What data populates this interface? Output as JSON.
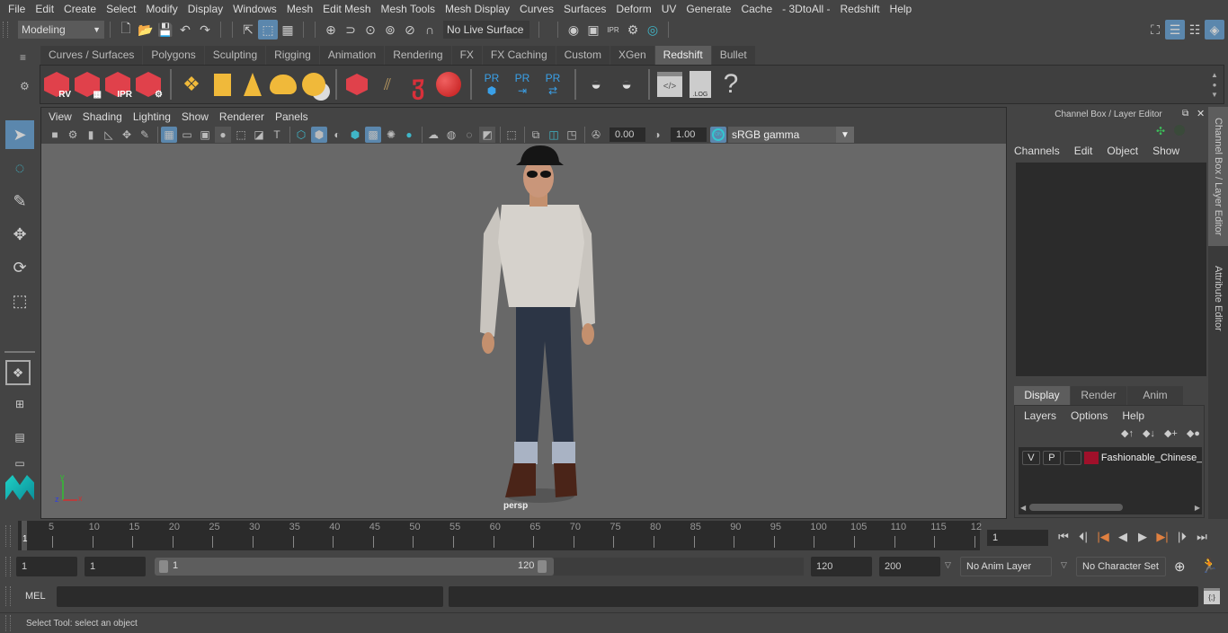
{
  "menubar": {
    "items": [
      "File",
      "Edit",
      "Create",
      "Select",
      "Modify",
      "Display",
      "Windows",
      "Mesh",
      "Edit Mesh",
      "Mesh Tools",
      "Mesh Display",
      "Curves",
      "Surfaces",
      "Deform",
      "UV",
      "Generate",
      "Cache",
      "- 3DtoAll -",
      "Redshift",
      "Help"
    ]
  },
  "statusline": {
    "mode": "Modeling",
    "live_surface": "No Live Surface"
  },
  "shelf": {
    "tabs": [
      "Curves / Surfaces",
      "Polygons",
      "Sculpting",
      "Rigging",
      "Animation",
      "Rendering",
      "FX",
      "FX Caching",
      "Custom",
      "XGen",
      "Redshift",
      "Bullet"
    ],
    "active_tab": "Redshift",
    "icons": {
      "rv": "RV",
      "ipr": "IPR",
      "pr": "PR",
      "log": ".LOG",
      "help": "?"
    }
  },
  "viewport": {
    "menu": [
      "View",
      "Shading",
      "Lighting",
      "Show",
      "Renderer",
      "Panels"
    ],
    "exposure": "0.00",
    "gamma": "1.00",
    "color_mgmt_on": "ON",
    "color_space": "sRGB gamma",
    "camera_label": "persp",
    "axis": {
      "x": "x",
      "y": "y",
      "z": "z"
    }
  },
  "channel_box": {
    "title": "Channel Box / Layer Editor",
    "menu": [
      "Channels",
      "Edit",
      "Object",
      "Show"
    ]
  },
  "layer_editor": {
    "tabs": [
      "Display",
      "Render",
      "Anim"
    ],
    "active_tab": "Display",
    "menu": [
      "Layers",
      "Options",
      "Help"
    ],
    "layers": [
      {
        "v": "V",
        "p": "P",
        "color": "#a0102a",
        "name": "Fashionable_Chinese_"
      }
    ]
  },
  "side_tabs": [
    "Channel Box / Layer Editor",
    "Attribute Editor"
  ],
  "timeline": {
    "ticks": [
      "5",
      "10",
      "15",
      "20",
      "25",
      "30",
      "35",
      "40",
      "45",
      "50",
      "55",
      "60",
      "65",
      "70",
      "75",
      "80",
      "85",
      "90",
      "95",
      "100",
      "105",
      "110",
      "115",
      "12"
    ],
    "current_frame_marker": "1",
    "current_frame": "1"
  },
  "range": {
    "start_time": "1",
    "playback_start": "1",
    "range_start_label": "1",
    "range_end_label": "120",
    "playback_end": "120",
    "end_time": "200",
    "anim_layer": "No Anim Layer",
    "character_set": "No Character Set"
  },
  "command_line": {
    "label": "MEL"
  },
  "help_line": {
    "text": "Select Tool: select an object"
  }
}
